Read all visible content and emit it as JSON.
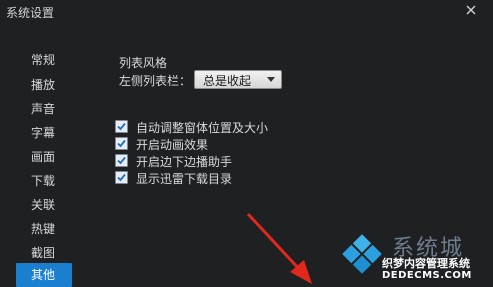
{
  "window": {
    "title": "系统设置"
  },
  "sidebar": {
    "items": [
      {
        "label": "常规",
        "active": false
      },
      {
        "label": "播放",
        "active": false
      },
      {
        "label": "声音",
        "active": false
      },
      {
        "label": "字幕",
        "active": false
      },
      {
        "label": "画面",
        "active": false
      },
      {
        "label": "下载",
        "active": false
      },
      {
        "label": "关联",
        "active": false
      },
      {
        "label": "热键",
        "active": false
      },
      {
        "label": "截图",
        "active": false
      },
      {
        "label": "其他",
        "active": true
      }
    ]
  },
  "content": {
    "section_title": "列表风格",
    "sidebar_list_label": "左侧列表栏：",
    "sidebar_list_value": "总是收起",
    "options": [
      {
        "label": "自动调整窗体位置及大小",
        "checked": true
      },
      {
        "label": "开启动画效果",
        "checked": true
      },
      {
        "label": "开启边下边播助手",
        "checked": true
      },
      {
        "label": "显示迅雷下载目录",
        "checked": true
      }
    ]
  },
  "watermark": {
    "line1": "系统城",
    "line2": "织梦内容管理系统",
    "line3": "DEDECMS.COM"
  },
  "colors": {
    "background": "#1e2022",
    "active_item": "#1b7fd0",
    "arrow": "#e0281e",
    "check": "#1a6fc4"
  }
}
